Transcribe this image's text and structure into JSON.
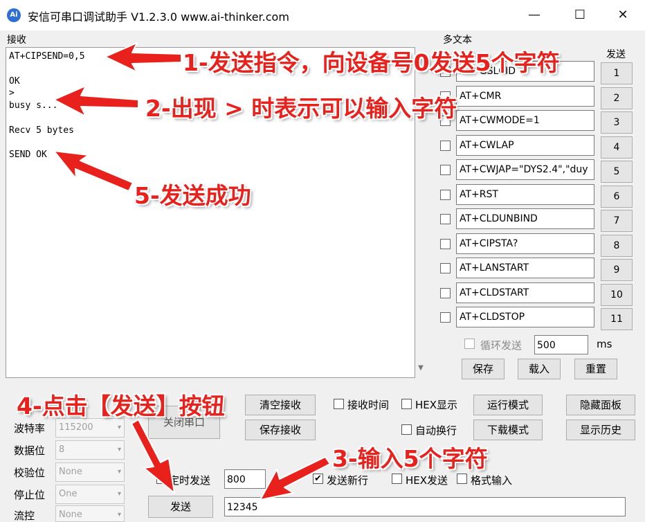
{
  "window": {
    "title": "安信可串口调试助手 V1.2.3.0    www.ai-thinker.com",
    "icon_text": "Ai",
    "minimize": "—",
    "maximize": "☐",
    "close": "✕"
  },
  "receive": {
    "label": "接收",
    "lines": [
      "AT+CIPSEND=0,5",
      "",
      "OK",
      ">",
      "busy s...",
      "",
      "Recv 5 bytes",
      "",
      "SEND OK"
    ]
  },
  "multitext": {
    "label": "多文本",
    "send_header": "发送",
    "items": [
      {
        "value": "AT+GSLCID",
        "button": "1"
      },
      {
        "value": "AT+CMR",
        "button": "2"
      },
      {
        "value": "AT+CWMODE=1",
        "button": "3"
      },
      {
        "value": "AT+CWLAP",
        "button": "4"
      },
      {
        "value": "AT+CWJAP=\"DYS2.4\",\"duy",
        "button": "5"
      },
      {
        "value": "AT+RST",
        "button": "6"
      },
      {
        "value": "AT+CLDUNBIND",
        "button": "7"
      },
      {
        "value": "AT+CIPSTA?",
        "button": "8"
      },
      {
        "value": "AT+LANSTART",
        "button": "9"
      },
      {
        "value": "AT+CLDSTART",
        "button": "10"
      },
      {
        "value": "AT+CLDSTOP",
        "button": "11"
      }
    ],
    "loop_send_label": "循环发送",
    "loop_interval": "500",
    "ms_label": "ms",
    "save_button": "保存",
    "load_button": "载入",
    "reset_button": "重置"
  },
  "port": {
    "baud_label": "波特率",
    "baud_value": "115200",
    "databits_label": "数据位",
    "databits_value": "8",
    "parity_label": "校验位",
    "parity_value": "None",
    "stopbits_label": "停止位",
    "stopbits_value": "One",
    "flow_label": "流控",
    "flow_value": "None",
    "close_port_button": "关闭串口"
  },
  "controls": {
    "clear_receive_button": "清空接收",
    "save_receive_button": "保存接收",
    "recv_time_label": "接收时间",
    "hex_display_label": "HEX显示",
    "auto_newline_label": "自动换行",
    "run_mode_button": "运行模式",
    "download_mode_button": "下载模式",
    "hide_panel_button": "隐藏面板",
    "show_history_button": "显示历史",
    "timed_send_label": "定时发送",
    "timed_interval": "800",
    "send_newline_label": "发送新行",
    "hex_send_label": "HEX发送",
    "format_input_label": "格式输入",
    "send_button": "发送",
    "send_input_value": "12345"
  },
  "annotations": {
    "step1": "1-发送指令，向设备号0发送5个字符",
    "step2": "2-出现 > 时表示可以输入字符",
    "step3": "3-输入5个字符",
    "step4": "4-点击【发送】按钮",
    "step5": "5-发送成功",
    "color": "#e8211c"
  }
}
